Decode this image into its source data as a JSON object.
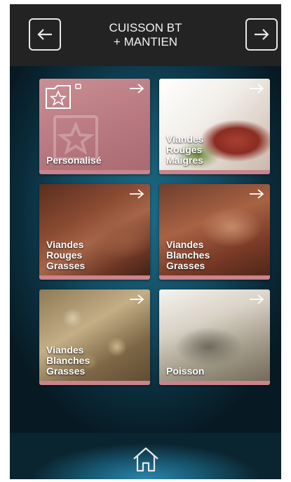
{
  "header": {
    "title_line1": "CUISSON BT",
    "title_line2": "+ MANTIEN"
  },
  "tiles": [
    {
      "label": "Personalisé"
    },
    {
      "label": "Viandes Rouges Maigres"
    },
    {
      "label": "Viandes Rouges Grasses"
    },
    {
      "label": "Viandes Blanches Grasses"
    },
    {
      "label": "Viandes Blanches Grasses"
    },
    {
      "label": "Poisson"
    }
  ],
  "icons": {
    "back": "arrow-left-icon",
    "forward": "arrow-right-icon",
    "tile_arrow": "arrow-right-icon",
    "custom": "folder-star-icon",
    "home": "home-icon"
  },
  "colors": {
    "header_bg": "#232323",
    "accent_pink": "#c9848c",
    "content_blue": "#1d6b86"
  }
}
